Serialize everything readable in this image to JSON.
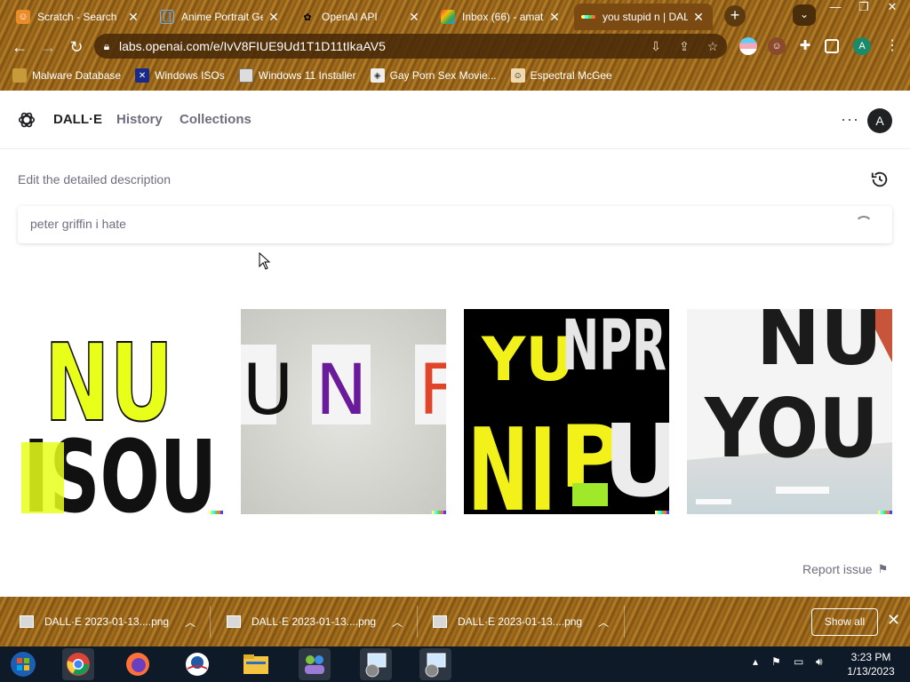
{
  "browser": {
    "tabs": [
      {
        "title": "Scratch - Search",
        "icon": "scratch-icon",
        "active": false
      },
      {
        "title": "Anime Portrait Ge",
        "icon": "brackets-icon",
        "active": false
      },
      {
        "title": "OpenAI API",
        "icon": "openai-icon",
        "active": false
      },
      {
        "title": "Inbox (66) - amat",
        "icon": "gmail-icon",
        "active": false
      },
      {
        "title": "you stupid n | DAL",
        "icon": "dalle-icon",
        "active": true
      }
    ],
    "new_tab_label": "+",
    "url": "labs.openai.com/e/IvV8FIUE9Ud1T1D11tIkaAV5",
    "profile_initial": "A",
    "bookmarks": [
      {
        "label": "Malware Database",
        "icon": "folder-icon"
      },
      {
        "label": "Windows ISOs",
        "icon": "x-icon"
      },
      {
        "label": "Windows 11 Installer",
        "icon": "image-icon"
      },
      {
        "label": "Gay Porn Sex Movie...",
        "icon": "cube-icon"
      },
      {
        "label": "Espectral McGee",
        "icon": "face-icon"
      }
    ]
  },
  "app": {
    "brand": "DALL·E",
    "nav": [
      "History",
      "Collections"
    ],
    "avatar_initial": "A",
    "more_label": "···",
    "description_label": "Edit the detailed description",
    "prompt_value": "peter griffin i hate",
    "report_label": "Report issue",
    "images": [
      {
        "lines": [
          "NU",
          "ISOU"
        ],
        "bg": "#ffffff"
      },
      {
        "lines": [
          "U",
          "N",
          "F"
        ],
        "bg": "#d6d6d2"
      },
      {
        "lines": [
          "YU",
          "NPR",
          "NI",
          "P",
          "U"
        ],
        "bg": "#000000"
      },
      {
        "lines": [
          "NU",
          "YOU"
        ],
        "bg": "#e8e8e8"
      }
    ]
  },
  "downloads": {
    "items": [
      "DALL·E 2023-01-13....png",
      "DALL·E 2023-01-13....png",
      "DALL·E 2023-01-13....png"
    ],
    "show_all": "Show all"
  },
  "taskbar": {
    "time": "3:23 PM",
    "date": "1/13/2023"
  }
}
